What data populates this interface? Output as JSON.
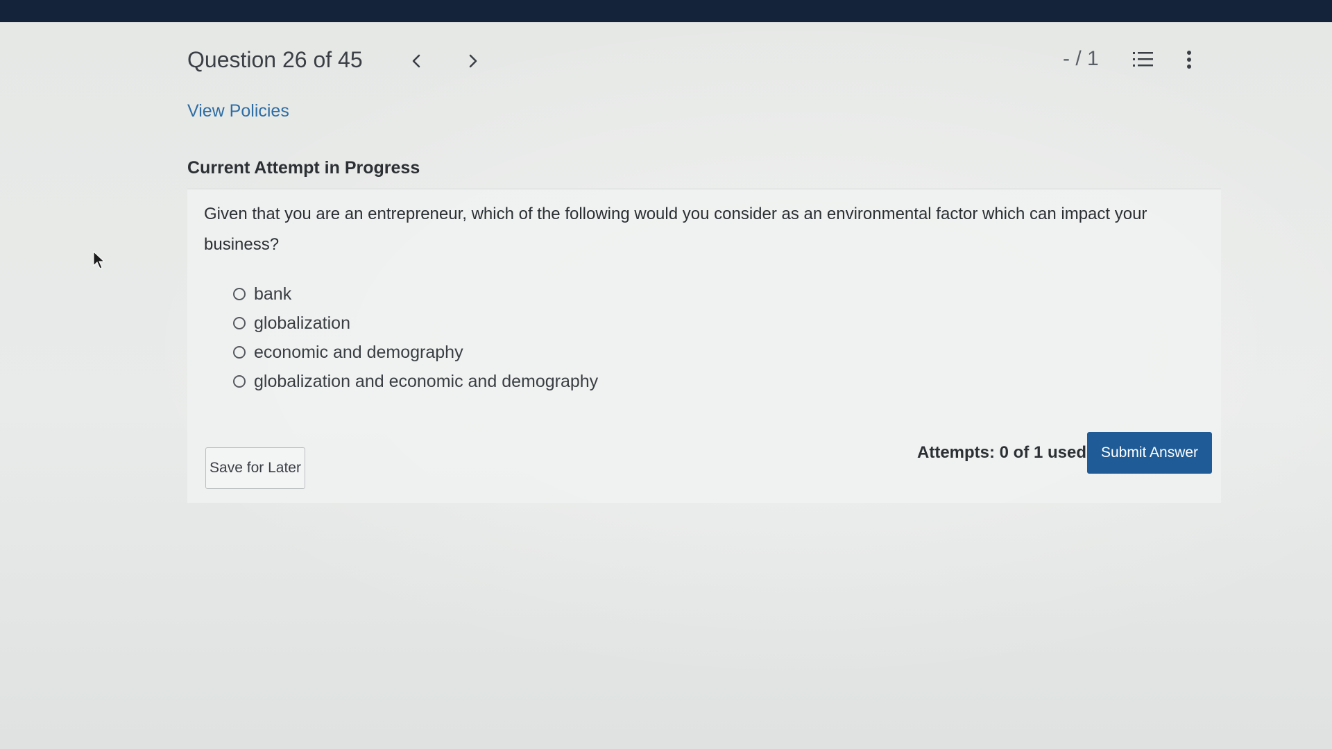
{
  "header": {
    "question_counter": "Question 26 of 45",
    "prev_icon": "chevron-left-icon",
    "next_icon": "chevron-right-icon",
    "score": "- / 1",
    "list_icon": "numbered-list-icon",
    "more_icon": "vertical-ellipsis-icon"
  },
  "links": {
    "view_policies": "View Policies"
  },
  "attempt": {
    "heading": "Current Attempt in Progress",
    "question": "Given that you are an entrepreneur, which of the following would you consider as an environmental factor which can impact your business?",
    "options": [
      {
        "label": "bank",
        "selected": false
      },
      {
        "label": "globalization",
        "selected": false
      },
      {
        "label": "economic and demography",
        "selected": false
      },
      {
        "label": "globalization and economic and demography",
        "selected": false
      }
    ],
    "save_label": "Save for Later",
    "attempts_text": "Attempts: 0 of 1 used",
    "submit_label": "Submit Answer"
  },
  "colors": {
    "top_bar": "#14223a",
    "link": "#2e6da4",
    "primary_button": "#1f5c97"
  }
}
